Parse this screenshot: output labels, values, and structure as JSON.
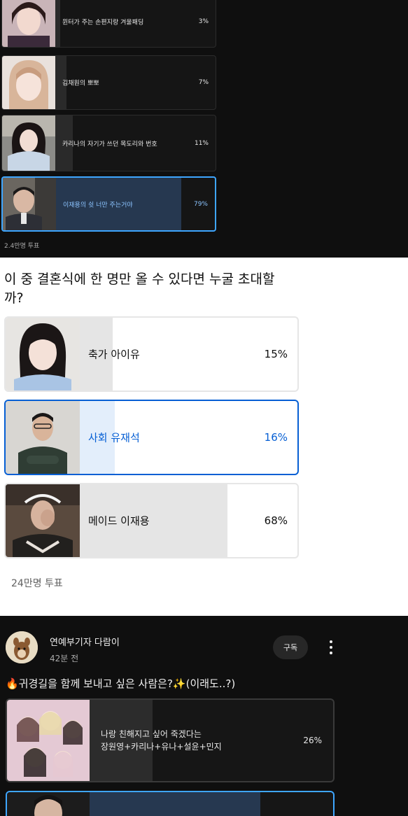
{
  "poll1": {
    "options": [
      {
        "label": "윈터가 주는 손편지랑 겨울패딩",
        "percent": "3%",
        "share": 0.03,
        "selected": false
      },
      {
        "label": "김채원의 뽀뽀",
        "percent": "7%",
        "share": 0.07,
        "selected": false
      },
      {
        "label": "카리나의 자기가 쓰던 목도리와 번호",
        "percent": "11%",
        "share": 0.11,
        "selected": false
      },
      {
        "label": "이재용의 쉿 너만 주는거야",
        "percent": "79%",
        "share": 0.79,
        "selected": true
      }
    ],
    "votes": "2.4만명 투표"
  },
  "poll2": {
    "question": "이 중 결혼식에 한 명만 올 수 있다면 누굴 초대할까?",
    "options": [
      {
        "label": "축가 아이유",
        "percent": "15%",
        "share": 0.15,
        "selected": false
      },
      {
        "label": "사회 유재석",
        "percent": "16%",
        "share": 0.16,
        "selected": true
      },
      {
        "label": "메이드 이재용",
        "percent": "68%",
        "share": 0.68,
        "selected": false
      }
    ],
    "votes": "24만명 투표"
  },
  "post": {
    "channel": "연예부기자 다람이",
    "time": "42분 전",
    "subscribe_label": "구독",
    "text": "🔥귀경길을 함께 보내고 싶은 사람은?✨(이래도..?)",
    "options": [
      {
        "label_line1": "나랑 친해지고 싶어 죽겠다는",
        "label_line2": "장원영+카리나+유나+설윤+민지",
        "percent": "26%",
        "share": 0.26,
        "selected": false
      },
      {
        "label_line1": "",
        "label_line2": "",
        "percent": "",
        "share": 0.7,
        "selected": true
      }
    ]
  },
  "colors": {
    "accent_dark": "#3ea6ff",
    "accent_light": "#065fd4",
    "dark_bg": "#0f0f0f",
    "light_bg": "#ffffff"
  }
}
